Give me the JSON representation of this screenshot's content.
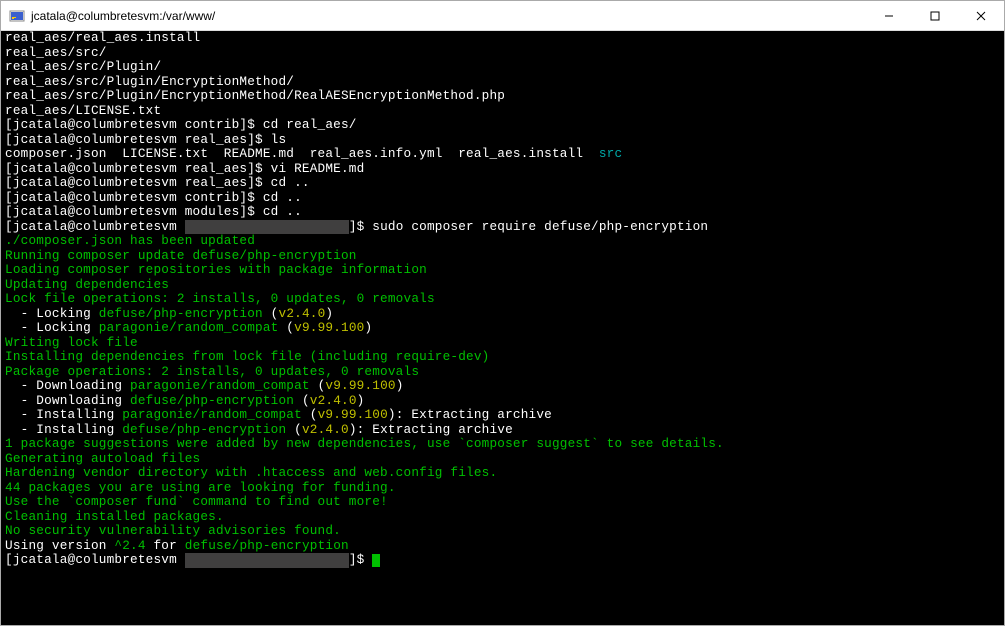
{
  "window_title": "jcatala@columbretesvm:/var/www/",
  "lines": [
    {
      "segments": [
        {
          "text": "real_aes/real_aes.install",
          "cls": "c-white"
        }
      ]
    },
    {
      "segments": [
        {
          "text": "real_aes/src/",
          "cls": "c-white"
        }
      ]
    },
    {
      "segments": [
        {
          "text": "real_aes/src/Plugin/",
          "cls": "c-white"
        }
      ]
    },
    {
      "segments": [
        {
          "text": "real_aes/src/Plugin/EncryptionMethod/",
          "cls": "c-white"
        }
      ]
    },
    {
      "segments": [
        {
          "text": "real_aes/src/Plugin/EncryptionMethod/RealAESEncryptionMethod.php",
          "cls": "c-white"
        }
      ]
    },
    {
      "segments": [
        {
          "text": "real_aes/LICENSE.txt",
          "cls": "c-white"
        }
      ]
    },
    {
      "segments": [
        {
          "text": "[jcatala@columbretesvm contrib]$ cd real_aes/",
          "cls": "c-white"
        }
      ]
    },
    {
      "segments": [
        {
          "text": "[jcatala@columbretesvm real_aes]$ ls",
          "cls": "c-white"
        }
      ]
    },
    {
      "segments": [
        {
          "text": "composer.json  LICENSE.txt  README.md  real_aes.info.yml  real_aes.install  ",
          "cls": "c-white"
        },
        {
          "text": "src",
          "cls": "c-cyan"
        }
      ]
    },
    {
      "segments": [
        {
          "text": "[jcatala@columbretesvm real_aes]$ vi README.md",
          "cls": "c-white"
        }
      ]
    },
    {
      "segments": [
        {
          "text": "[jcatala@columbretesvm real_aes]$ cd ..",
          "cls": "c-white"
        }
      ]
    },
    {
      "segments": [
        {
          "text": "[jcatala@columbretesvm contrib]$ cd ..",
          "cls": "c-white"
        }
      ]
    },
    {
      "segments": [
        {
          "text": "[jcatala@columbretesvm modules]$ cd ..",
          "cls": "c-white"
        }
      ]
    },
    {
      "segments": [
        {
          "text": "[jcatala@columbretesvm ",
          "cls": "c-white"
        },
        {
          "text": "                     ",
          "cls": "redacted"
        },
        {
          "text": "]$ sudo composer require defuse/php-encryption",
          "cls": "c-white"
        }
      ]
    },
    {
      "segments": [
        {
          "text": "./composer.json has been updated",
          "cls": "c-green"
        }
      ]
    },
    {
      "segments": [
        {
          "text": "Running composer update defuse/php-encryption",
          "cls": "c-green"
        }
      ]
    },
    {
      "segments": [
        {
          "text": "Loading composer repositories with package information",
          "cls": "c-green"
        }
      ]
    },
    {
      "segments": [
        {
          "text": "Updating dependencies",
          "cls": "c-green"
        }
      ]
    },
    {
      "segments": [
        {
          "text": "Lock file operations: 2 installs, 0 updates, 0 removals",
          "cls": "c-green"
        }
      ]
    },
    {
      "segments": [
        {
          "text": "  - Locking ",
          "cls": "c-white"
        },
        {
          "text": "defuse/php-encryption",
          "cls": "c-green"
        },
        {
          "text": " (",
          "cls": "c-white"
        },
        {
          "text": "v2.4.0",
          "cls": "c-yellow"
        },
        {
          "text": ")",
          "cls": "c-white"
        }
      ]
    },
    {
      "segments": [
        {
          "text": "  - Locking ",
          "cls": "c-white"
        },
        {
          "text": "paragonie/random_compat",
          "cls": "c-green"
        },
        {
          "text": " (",
          "cls": "c-white"
        },
        {
          "text": "v9.99.100",
          "cls": "c-yellow"
        },
        {
          "text": ")",
          "cls": "c-white"
        }
      ]
    },
    {
      "segments": [
        {
          "text": "Writing lock file",
          "cls": "c-green"
        }
      ]
    },
    {
      "segments": [
        {
          "text": "Installing dependencies from lock file (including require-dev)",
          "cls": "c-green"
        }
      ]
    },
    {
      "segments": [
        {
          "text": "Package operations: 2 installs, 0 updates, 0 removals",
          "cls": "c-green"
        }
      ]
    },
    {
      "segments": [
        {
          "text": "  - Downloading ",
          "cls": "c-white"
        },
        {
          "text": "paragonie/random_compat",
          "cls": "c-green"
        },
        {
          "text": " (",
          "cls": "c-white"
        },
        {
          "text": "v9.99.100",
          "cls": "c-yellow"
        },
        {
          "text": ")",
          "cls": "c-white"
        }
      ]
    },
    {
      "segments": [
        {
          "text": "  - Downloading ",
          "cls": "c-white"
        },
        {
          "text": "defuse/php-encryption",
          "cls": "c-green"
        },
        {
          "text": " (",
          "cls": "c-white"
        },
        {
          "text": "v2.4.0",
          "cls": "c-yellow"
        },
        {
          "text": ")",
          "cls": "c-white"
        }
      ]
    },
    {
      "segments": [
        {
          "text": "  - Installing ",
          "cls": "c-white"
        },
        {
          "text": "paragonie/random_compat",
          "cls": "c-green"
        },
        {
          "text": " (",
          "cls": "c-white"
        },
        {
          "text": "v9.99.100",
          "cls": "c-yellow"
        },
        {
          "text": "): Extracting archive",
          "cls": "c-white"
        }
      ]
    },
    {
      "segments": [
        {
          "text": "  - Installing ",
          "cls": "c-white"
        },
        {
          "text": "defuse/php-encryption",
          "cls": "c-green"
        },
        {
          "text": " (",
          "cls": "c-white"
        },
        {
          "text": "v2.4.0",
          "cls": "c-yellow"
        },
        {
          "text": "): Extracting archive",
          "cls": "c-white"
        }
      ]
    },
    {
      "segments": [
        {
          "text": "1 package suggestions were added by new dependencies, use `composer suggest` to see details.",
          "cls": "c-green"
        }
      ]
    },
    {
      "segments": [
        {
          "text": "Generating autoload files",
          "cls": "c-green"
        }
      ]
    },
    {
      "segments": [
        {
          "text": "Hardening vendor directory with .htaccess and web.config files.",
          "cls": "c-green"
        }
      ]
    },
    {
      "segments": [
        {
          "text": "44 packages you are using are looking for funding.",
          "cls": "c-green"
        }
      ]
    },
    {
      "segments": [
        {
          "text": "Use the `composer fund` command to find out more!",
          "cls": "c-green"
        }
      ]
    },
    {
      "segments": [
        {
          "text": "Cleaning installed packages.",
          "cls": "c-green"
        }
      ]
    },
    {
      "segments": [
        {
          "text": "No security vulnerability advisories found.",
          "cls": "c-green"
        }
      ]
    },
    {
      "segments": [
        {
          "text": "Using version ",
          "cls": "c-white"
        },
        {
          "text": "^2.4",
          "cls": "c-green"
        },
        {
          "text": " for ",
          "cls": "c-white"
        },
        {
          "text": "defuse/php-encryption",
          "cls": "c-green"
        }
      ]
    },
    {
      "segments": [
        {
          "text": "[jcatala@columbretesvm ",
          "cls": "c-white"
        },
        {
          "text": "                     ",
          "cls": "redacted"
        },
        {
          "text": "]$ ",
          "cls": "c-white"
        }
      ],
      "cursor": true
    }
  ]
}
